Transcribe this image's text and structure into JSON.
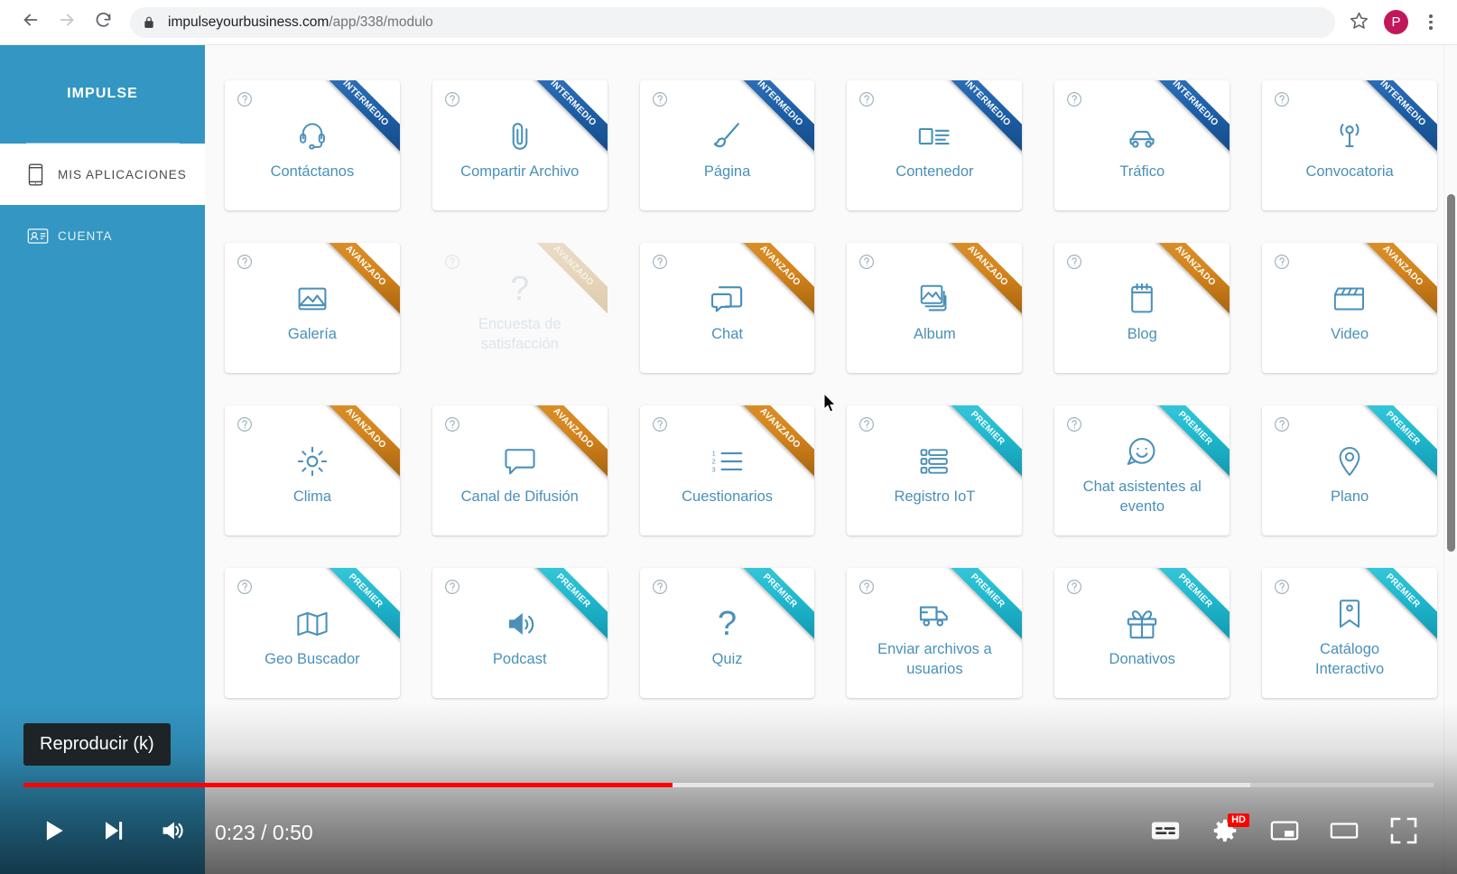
{
  "browser": {
    "back_icon": "back-arrow-icon",
    "forward_icon": "forward-arrow-icon",
    "reload_icon": "reload-icon",
    "lock_icon": "lock-icon",
    "url_domain": "impulseyourbusiness.com",
    "url_path": "/app/338/modulo",
    "bookmark_icon": "star-icon",
    "profile_initial": "P",
    "profile_color": "#c2185b",
    "menu_icon": "kebab-menu-icon"
  },
  "sidebar": {
    "brand": "IMPULSE",
    "bg_color": "#3396c3",
    "items": [
      {
        "label": "MIS APLICACIONES",
        "icon": "mobile-phone-icon",
        "active": true
      },
      {
        "label": "CUENTA",
        "icon": "id-card-icon",
        "active": false
      }
    ]
  },
  "badges": {
    "intermedio": "INTERMEDIO",
    "avanzado": "AVANZADO",
    "premier": "PREMIER",
    "colors": {
      "intermedio": "#1e5fa8",
      "avanzado": "#d4841c",
      "premier": "#20b9cf"
    }
  },
  "grid": {
    "help_icon": "question-circle-icon",
    "clipped_row_count": 6,
    "cards": [
      {
        "label": "Contáctanos",
        "icon": "headset-icon",
        "badge": "INTERMEDIO",
        "tier": "intermedio",
        "disabled": false
      },
      {
        "label": "Compartir Archivo",
        "icon": "paperclip-icon",
        "badge": "INTERMEDIO",
        "tier": "intermedio",
        "disabled": false
      },
      {
        "label": "Página",
        "icon": "brush-icon",
        "badge": "INTERMEDIO",
        "tier": "intermedio",
        "disabled": false
      },
      {
        "label": "Contenedor",
        "icon": "layout-list-icon",
        "badge": "INTERMEDIO",
        "tier": "intermedio",
        "disabled": false
      },
      {
        "label": "Tráfico",
        "icon": "car-icon",
        "badge": "INTERMEDIO",
        "tier": "intermedio",
        "disabled": false
      },
      {
        "label": "Convocatoria",
        "icon": "broadcast-icon",
        "badge": "INTERMEDIO",
        "tier": "intermedio",
        "disabled": false
      },
      {
        "label": "Galería",
        "icon": "image-icon",
        "badge": "AVANZADO",
        "tier": "avanzado",
        "disabled": false
      },
      {
        "label": "Encuesta de satisfacción",
        "icon": "question-mark-icon",
        "badge": "AVANZADO",
        "tier": "avanzado",
        "disabled": true
      },
      {
        "label": "Chat",
        "icon": "chat-bubbles-icon",
        "badge": "AVANZADO",
        "tier": "avanzado",
        "disabled": false
      },
      {
        "label": "Album",
        "icon": "photos-stack-icon",
        "badge": "AVANZADO",
        "tier": "avanzado",
        "disabled": false
      },
      {
        "label": "Blog",
        "icon": "notepad-icon",
        "badge": "AVANZADO",
        "tier": "avanzado",
        "disabled": false
      },
      {
        "label": "Video",
        "icon": "clapperboard-icon",
        "badge": "AVANZADO",
        "tier": "avanzado",
        "disabled": false
      },
      {
        "label": "Clima",
        "icon": "sun-icon",
        "badge": "AVANZADO",
        "tier": "avanzado",
        "disabled": false
      },
      {
        "label": "Canal de Difusión",
        "icon": "speech-bubble-icon",
        "badge": "AVANZADO",
        "tier": "avanzado",
        "disabled": false
      },
      {
        "label": "Cuestionarios",
        "icon": "ordered-list-icon",
        "badge": "AVANZADO",
        "tier": "avanzado",
        "disabled": false
      },
      {
        "label": "Registro IoT",
        "icon": "list-records-icon",
        "badge": "PREMIER",
        "tier": "premier",
        "disabled": false
      },
      {
        "label": "Chat asistentes al evento",
        "icon": "smiley-chat-icon",
        "badge": "PREMIER",
        "tier": "premier",
        "disabled": false
      },
      {
        "label": "Plano",
        "icon": "map-pin-icon",
        "badge": "PREMIER",
        "tier": "premier",
        "disabled": false
      },
      {
        "label": "Geo Buscador",
        "icon": "folded-map-icon",
        "badge": "PREMIER",
        "tier": "premier",
        "disabled": false
      },
      {
        "label": "Podcast",
        "icon": "speaker-icon",
        "badge": "PREMIER",
        "tier": "premier",
        "disabled": false
      },
      {
        "label": "Quiz",
        "icon": "question-mark-icon",
        "badge": "PREMIER",
        "tier": "premier",
        "disabled": false
      },
      {
        "label": "Enviar archivos a usuarios",
        "icon": "delivery-truck-icon",
        "badge": "PREMIER",
        "tier": "premier",
        "disabled": false
      },
      {
        "label": "Donativos",
        "icon": "gift-icon",
        "badge": "PREMIER",
        "tier": "premier",
        "disabled": false
      },
      {
        "label": "Catálogo Interactivo",
        "icon": "bookmark-tag-icon",
        "badge": "PREMIER",
        "tier": "premier",
        "disabled": false
      }
    ]
  },
  "player": {
    "tooltip": "Reproducir (k)",
    "time_display": "0:23 / 0:50",
    "current_time": "0:23",
    "duration": "0:50",
    "played_percent": 46,
    "loaded_percent": 87,
    "progress_color": "#ff0000",
    "quality_badge": "HD",
    "controls_left": [
      {
        "name": "play-button",
        "icon": "play-icon"
      },
      {
        "name": "next-button",
        "icon": "next-track-icon"
      },
      {
        "name": "volume-button",
        "icon": "volume-icon"
      }
    ],
    "controls_right": [
      {
        "name": "subtitles-button",
        "icon": "subtitles-icon"
      },
      {
        "name": "settings-button",
        "icon": "gear-icon"
      },
      {
        "name": "miniplayer-button",
        "icon": "miniplayer-icon"
      },
      {
        "name": "theater-button",
        "icon": "theater-mode-icon"
      },
      {
        "name": "fullscreen-button",
        "icon": "fullscreen-icon"
      }
    ]
  }
}
